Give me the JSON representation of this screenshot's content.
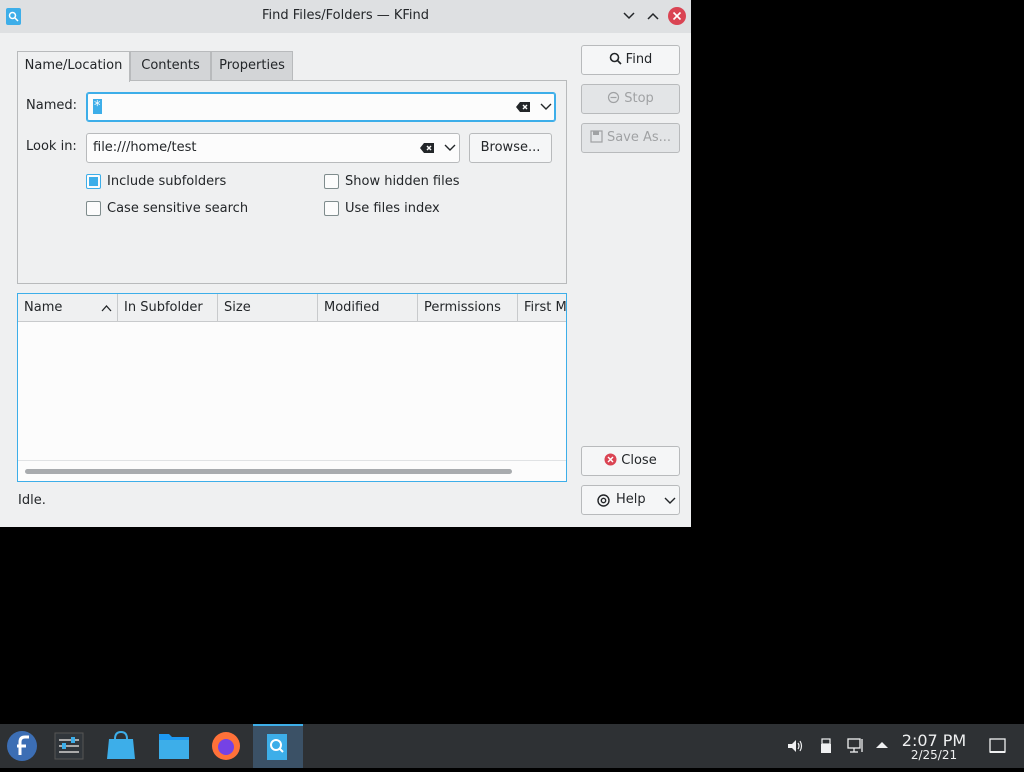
{
  "window": {
    "title": "Find Files/Folders — KFind"
  },
  "tabs": [
    {
      "label": "Name/Location"
    },
    {
      "label": "Contents"
    },
    {
      "label": "Properties"
    }
  ],
  "form": {
    "named_label": "Named:",
    "named_value": "*",
    "look_in_label": "Look in:",
    "look_in_value": "file:///home/test",
    "browse_label": "Browse...",
    "include_subfolders": "Include subfolders",
    "case_sensitive": "Case sensitive search",
    "show_hidden": "Show hidden files",
    "use_index": "Use files index"
  },
  "buttons": {
    "find": "Find",
    "stop": "Stop",
    "save_as": "Save As...",
    "close": "Close",
    "help": "Help"
  },
  "results": {
    "columns": [
      "Name",
      "In Subfolder",
      "Size",
      "Modified",
      "Permissions",
      "First M"
    ]
  },
  "status": "Idle.",
  "taskbar": {
    "time": "2:07 PM",
    "date": "2/25/21"
  },
  "colors": {
    "accent": "#3daee9",
    "close": "#da4453"
  }
}
